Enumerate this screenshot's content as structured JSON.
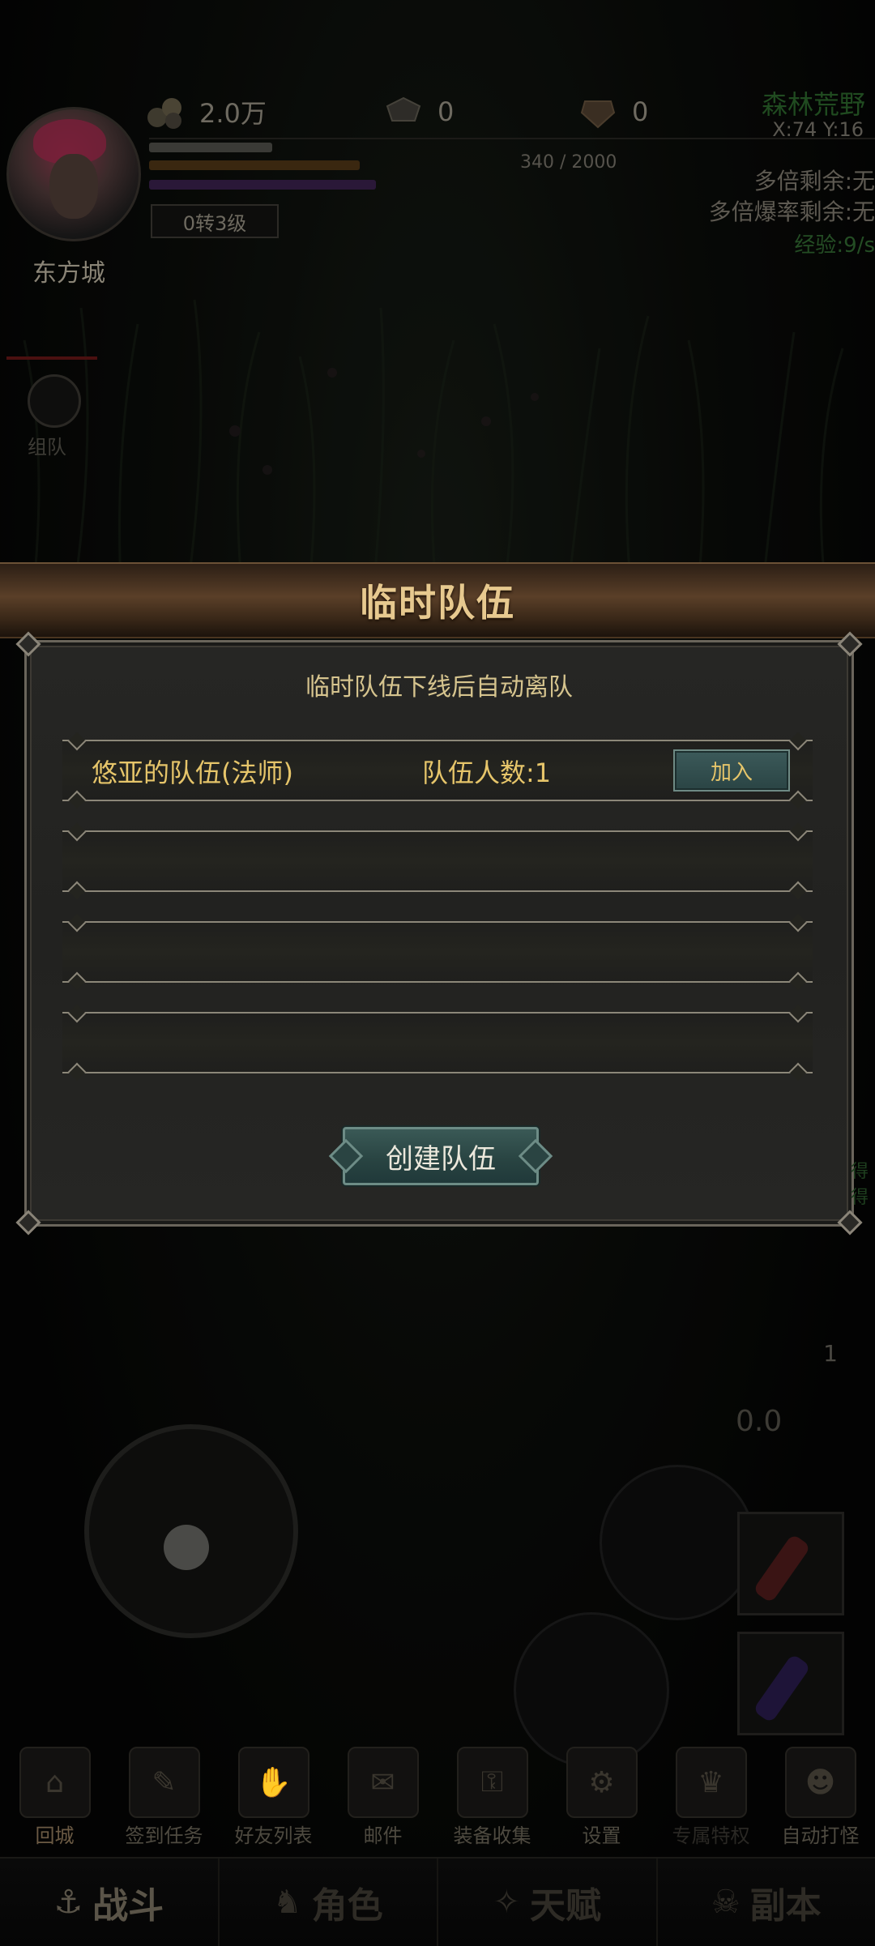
{
  "hud": {
    "city": "东方城",
    "gold": "2.0万",
    "gem_a": "0",
    "gem_b": "0",
    "level": "0转3级",
    "hp_text": "340 / 2000",
    "map_name": "森林荒野",
    "coords": "X:74 Y:16",
    "multi_left": "多倍剩余:无",
    "drop_left": "多倍爆率剩余:无",
    "exp_rate": "经验:9/s",
    "team_label": "组队",
    "side_number": "1",
    "side_value": "0.0",
    "right_edge_a": "得",
    "right_edge_b": "得"
  },
  "dialog": {
    "title": "临时队伍",
    "notice": "临时队伍下线后自动离队",
    "teams": [
      {
        "name": "悠亚的队伍(法师)",
        "count": "队伍人数:1",
        "join": "加入"
      }
    ],
    "create_label": "创建队伍"
  },
  "menu": [
    {
      "label": "回城",
      "icon": "home-icon"
    },
    {
      "label": "签到任务",
      "icon": "scroll-icon"
    },
    {
      "label": "好友列表",
      "icon": "handshake-icon"
    },
    {
      "label": "邮件",
      "icon": "mail-icon"
    },
    {
      "label": "装备收集",
      "icon": "lock-icon"
    },
    {
      "label": "设置",
      "icon": "gear-icon"
    },
    {
      "label": "专属特权",
      "icon": "crown-icon"
    },
    {
      "label": "自动打怪",
      "icon": "auto-fight-icon"
    }
  ],
  "tabs": [
    {
      "label": "战斗",
      "icon": "anchor-icon"
    },
    {
      "label": "角色",
      "icon": "character-icon"
    },
    {
      "label": "天赋",
      "icon": "talent-icon"
    },
    {
      "label": "副本",
      "icon": "dungeon-icon"
    }
  ],
  "colors": {
    "title_gold": "#e7c98f",
    "text_gold": "#e6c56a",
    "button_teal": "#2a4444"
  }
}
